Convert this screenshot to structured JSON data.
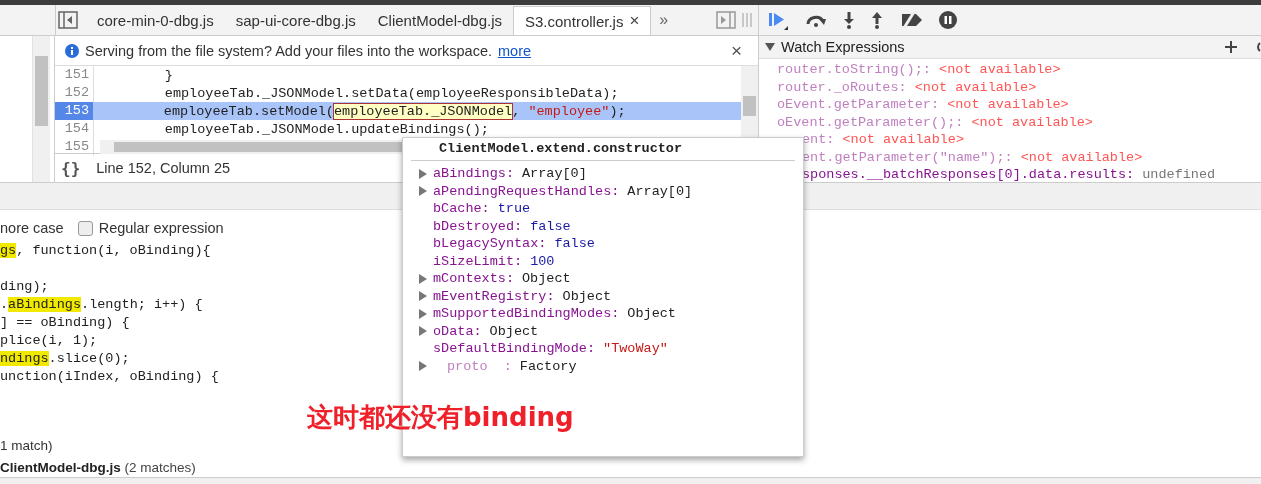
{
  "tabs": [
    {
      "label": "core-min-0-dbg.js",
      "selected": false
    },
    {
      "label": "sap-ui-core-dbg.js",
      "selected": false
    },
    {
      "label": "ClientModel-dbg.js",
      "selected": false
    },
    {
      "label": "S3.controller.js",
      "selected": true,
      "close": "×"
    }
  ],
  "tabs_overflow": "»",
  "infobar": {
    "message": "Serving from the file system? Add your files into the workspace.",
    "link": "more",
    "close": "×"
  },
  "code_lines": [
    {
      "number": "151",
      "current": false,
      "parts": [
        {
          "kind": "plain",
          "text": "        }"
        }
      ]
    },
    {
      "number": "152",
      "current": false,
      "parts": [
        {
          "kind": "plain",
          "text": "        employeeTab._JSONModel.setData(employeeResponsibleData);"
        }
      ]
    },
    {
      "number": "153",
      "current": true,
      "parts": [
        {
          "kind": "plain",
          "text": "        employeeTab.setModel("
        },
        {
          "kind": "hover",
          "text": "employeeTab._JSONModel"
        },
        {
          "kind": "plain",
          "text": ", "
        },
        {
          "kind": "string",
          "text": "\"employee\""
        },
        {
          "kind": "plain",
          "text": ");"
        }
      ]
    },
    {
      "number": "154",
      "current": false,
      "parts": [
        {
          "kind": "plain",
          "text": "        employeeTab._JSONModel.updateBindings();"
        }
      ]
    },
    {
      "number": "155",
      "current": false
    }
  ],
  "status": {
    "pretty_print": "{}",
    "position": "Line 152, Column 25"
  },
  "watch": {
    "title": "Watch Expressions",
    "expanded": true,
    "rows": [
      {
        "name": "router.toString();:",
        "value": "<not available>",
        "available": false,
        "partial": false
      },
      {
        "name": "router._oRoutes:",
        "value": "<not available>",
        "available": false,
        "partial": false
      },
      {
        "name": "oEvent.getParameter:",
        "value": "<not available>",
        "available": false,
        "partial": false
      },
      {
        "name": "oEvent.getParameter();:",
        "value": "<not available>",
        "available": false,
        "partial": false
      },
      {
        "name": "ent:",
        "value": "<not available>",
        "available": false,
        "partial": true
      },
      {
        "name": "ent.getParameter(\"name\");:",
        "value": "<not available>",
        "available": false,
        "partial": true
      },
      {
        "name": "sponses.__batchResponses[0].data.results:",
        "value": "undefined",
        "available": true,
        "partial": true
      }
    ]
  },
  "search": {
    "ignore_case_label": "nore case",
    "regex": {
      "label": "Regular expression",
      "checked": false
    },
    "lines": [
      {
        "parts": [
          {
            "text": "gs",
            "highlighted": true
          },
          {
            "text": ", function(i, oBinding){",
            "highlighted": false
          }
        ]
      },
      {
        "blank": true
      },
      {
        "parts": [
          {
            "text": "ding);",
            "highlighted": false
          }
        ]
      },
      {
        "parts": [
          {
            "text": ".",
            "highlighted": false
          },
          {
            "text": "aBindings",
            "highlighted": true
          },
          {
            "text": ".length; i++) {",
            "highlighted": false
          }
        ]
      },
      {
        "parts": [
          {
            "text": "] == oBinding) {",
            "highlighted": false
          }
        ]
      },
      {
        "parts": [
          {
            "text": "plice(i, 1);",
            "highlighted": false
          }
        ]
      },
      {
        "parts": [
          {
            "text": "ndings",
            "highlighted": true
          },
          {
            "text": ".slice(0);",
            "highlighted": false
          }
        ]
      },
      {
        "parts": [
          {
            "text": "unction(iIndex, oBinding) {",
            "highlighted": false
          }
        ]
      }
    ],
    "match_count": "1 match)",
    "file": {
      "name": "ClientModel-dbg.js",
      "count": "(2 matches)"
    }
  },
  "popover": {
    "title": "ClientModel.extend.constructor",
    "properties": [
      {
        "name": "aBindings:",
        "value": "Array[0]",
        "expandable": true,
        "kind": "object"
      },
      {
        "name": "aPendingRequestHandles:",
        "value": "Array[0]",
        "expandable": true,
        "kind": "object"
      },
      {
        "name": "bCache:",
        "value": "true",
        "expandable": false,
        "kind": "boolean"
      },
      {
        "name": "bDestroyed:",
        "value": "false",
        "expandable": false,
        "kind": "boolean"
      },
      {
        "name": "bLegacySyntax:",
        "value": "false",
        "expandable": false,
        "kind": "boolean"
      },
      {
        "name": "iSizeLimit:",
        "value": "100",
        "expandable": false,
        "kind": "number"
      },
      {
        "name": "mContexts:",
        "value": "Object",
        "expandable": true,
        "kind": "object"
      },
      {
        "name": "mEventRegistry:",
        "value": "Object",
        "expandable": true,
        "kind": "object"
      },
      {
        "name": "mSupportedBindingModes:",
        "value": "Object",
        "expandable": true,
        "kind": "object"
      },
      {
        "name": "oData:",
        "value": "Object",
        "expandable": true,
        "kind": "object"
      },
      {
        "name": "sDefaultBindingMode:",
        "value": "\"TwoWay\"",
        "expandable": false,
        "kind": "string"
      },
      {
        "name": "proto  :",
        "value": "Factory",
        "expandable": true,
        "kind": "internal"
      }
    ]
  },
  "annotation": "这时都还没有binding"
}
